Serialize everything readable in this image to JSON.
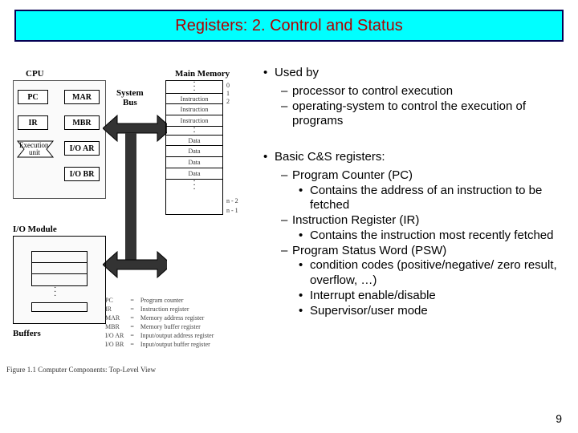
{
  "title": "Registers:  2. Control and Status",
  "content": {
    "b1a": "Used by",
    "b1a_sub": [
      "processor to control execution",
      "operating-system to control the execution of programs"
    ],
    "b1b": "Basic C&S registers:",
    "reg1_name": "Program Counter (PC)",
    "reg1_detail": "Contains the address of an instruction to be fetched",
    "reg2_name": "Instruction Register (IR)",
    "reg2_detail": "Contains the instruction most recently fetched",
    "reg3_name": "Program Status Word (PSW)",
    "reg3_details": [
      "condition codes (positive/negative/ zero  result, overflow, …)",
      "Interrupt enable/disable",
      "Supervisor/user mode"
    ]
  },
  "figure": {
    "cpu_label": "CPU",
    "system_bus": "System",
    "bus": "Bus",
    "main_memory": "Main Memory",
    "pc": "PC",
    "mar": "MAR",
    "ir": "IR",
    "mbr": "MBR",
    "exec_unit": "Execution",
    "exec_unit2": "unit",
    "io_ar": "I/O AR",
    "io_br": "I/O BR",
    "io_module": "I/O Module",
    "buffers": "Buffers",
    "instruction": "Instruction",
    "data": "Data",
    "idx0": "0",
    "idx1": "1",
    "idx2": "2",
    "idxn2": "n - 2",
    "idxn1": "n - 1",
    "legend": {
      "pc": "Program counter",
      "ir": "Instruction register",
      "mar": "Memory address register",
      "mbr": "Memory buffer register",
      "ioar": "Input/output address register",
      "iobr": "Input/output buffer register"
    },
    "caption": "Figure 1.1   Computer Components: Top-Level View"
  },
  "page_number": "9"
}
